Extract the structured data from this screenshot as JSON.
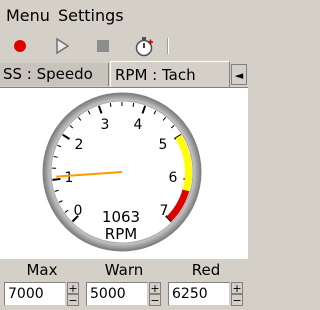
{
  "menu": {
    "menu_label": "Menu",
    "settings_label": "Settings"
  },
  "toolbar": {
    "record_icon": "record-icon",
    "play_icon": "play-icon",
    "stop_icon": "stop-icon",
    "timer_icon": "stopwatch-icon"
  },
  "tabs": {
    "inactive_label": "SS : Speedo",
    "active_label": "RPM : Tach",
    "left_arrow": "◄",
    "right_arrow": "►"
  },
  "gauge": {
    "tick_labels": [
      "0",
      "1",
      "2",
      "3",
      "4",
      "5",
      "6",
      "7"
    ],
    "value": "1063",
    "unit": "RPM",
    "needle_rpm": 1063,
    "max_rpm": 7000,
    "warn_rpm": 5000,
    "red_rpm": 6250,
    "colors": {
      "yellow": "#ffff00",
      "red": "#dd0000",
      "needle": "#ff9900"
    }
  },
  "fields": {
    "max_label": "Max",
    "max_value": "7000",
    "warn_label": "Warn",
    "warn_value": "5000",
    "red_label": "Red",
    "red_value": "6250",
    "plus": "+",
    "minus": "−"
  }
}
